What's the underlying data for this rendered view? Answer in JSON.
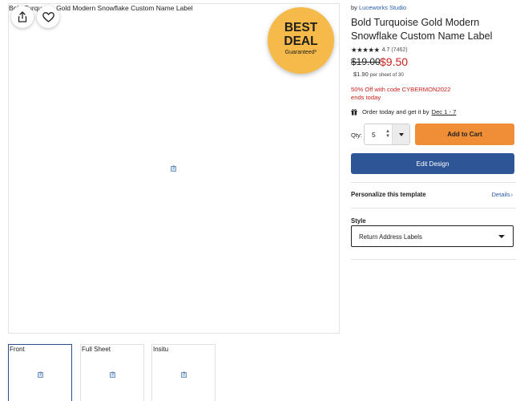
{
  "main_image": {
    "alt_text": "Bold Turquoise Gold Modern Snowflake Custom Name Label"
  },
  "actions": {
    "share_icon": "share-icon",
    "favorite_icon": "heart-icon"
  },
  "badge": {
    "line1": "BEST",
    "line2": "DEAL",
    "line3": "Guaranteed*",
    "color": "#f5ba4a"
  },
  "thumbnails": [
    {
      "label": "Front",
      "active": true
    },
    {
      "label": "Full Sheet",
      "active": false
    },
    {
      "label": "Insitu",
      "active": false
    }
  ],
  "product": {
    "by_prefix": "by",
    "brand": "Luceworks Studio",
    "title": "Bold Turquoise Gold Modern Snowflake Custom Name Label",
    "stars": "★★★★★",
    "rating": "4.7",
    "review_count": "(7462)",
    "old_price": "$19.00",
    "new_price": "$9.50",
    "unit_price": "$1.90",
    "unit_price_suffix": "per sheet of 30",
    "promo_line1": "50% Off with code CYBERMON2022",
    "promo_line2": "ends today",
    "delivery_text": "Order today and get it by",
    "delivery_date": "Dec 1 - 7",
    "sale_color": "#c8231f"
  },
  "purchase": {
    "qty_label": "Qty:",
    "qty_value": "5",
    "add_to_cart": "Add to Cart",
    "edit_design": "Edit Design",
    "cart_color": "#f08e37",
    "edit_color": "#2e5596"
  },
  "personalize": {
    "label": "Personalize this template",
    "details_link": "Details"
  },
  "style": {
    "label": "Style",
    "selected": "Return Address Labels"
  }
}
